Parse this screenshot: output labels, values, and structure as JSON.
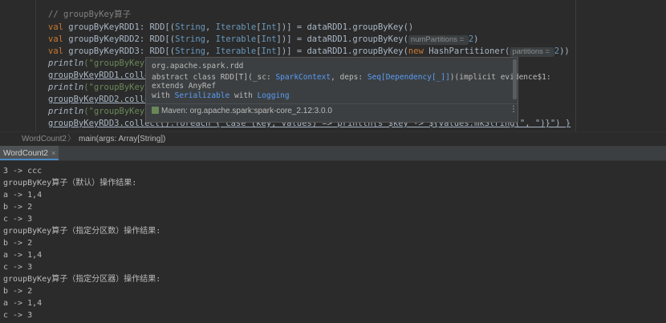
{
  "editor": {
    "lines": [
      {
        "comment": "// groupByKey算子"
      },
      {
        "val": "val",
        "name": "groupByKeyRDD1",
        "type_open": ": RDD[(",
        "t1": "String",
        "comma": ", ",
        "t2": "Iterable",
        "br": "[",
        "t3": "Int",
        "close": "])] = dataRDD1.groupByKey()"
      },
      {
        "val": "val",
        "name": "groupByKeyRDD2",
        "type_open": ": RDD[(",
        "t1": "String",
        "comma": ", ",
        "t2": "Iterable",
        "br": "[",
        "t3": "Int",
        "close": "])] = dataRDD1.groupByKey(",
        "hint": "numPartitions = ",
        "arg": "2",
        "end": ")"
      },
      {
        "val": "val",
        "name": "groupByKeyRDD3",
        "type_open": ": RDD[(",
        "t1": "String",
        "comma": ", ",
        "t2": "Iterable",
        "br": "[",
        "t3": "Int",
        "close": "])] = dataRDD1.groupByKey(",
        "new_kw": "new",
        "ctor": " HashPartitioner(",
        "hint": "partitions = ",
        "arg": "2",
        "end": "))"
      },
      {
        "fn": "println",
        "rest": "(\"groupByKey算"
      },
      {
        "text": "groupByKeyRDD1.collec"
      },
      {
        "fn": "println",
        "rest": "(\"groupByKey算"
      },
      {
        "text": "groupByKeyRDD2.collec"
      },
      {
        "fn": "println",
        "rest": "(\"groupByKey算"
      },
      {
        "text": "groupByKeyRDD3.collect().foreach { case (key, values) => println(s\"$key -> ${values.mkString(\", \")}\") }"
      }
    ]
  },
  "popup": {
    "package": "org.apache.spark.rdd",
    "sig_a": "abstract class RDD[T](_sc: ",
    "sig_b": "SparkContext",
    "sig_c": ", deps: ",
    "sig_d": "Seq[Dependency[_]]",
    "sig_e": ")(implicit evidence$1:",
    "extends": "extends AnyRef",
    "with_a": "with ",
    "with_b": "Serializable",
    "with_c": " with ",
    "with_d": "Logging",
    "maven": "Maven: org.apache.spark:spark-core_2.12:3.0.0",
    "more_icon": "⋮"
  },
  "breadcrumb": {
    "item1": "WordCount2",
    "sep": "〉",
    "item2": "main(args: Array[String])"
  },
  "tabs": [
    {
      "label": "WordCount2",
      "close": "×"
    }
  ],
  "console": {
    "lines": [
      "3 -> ccc",
      "groupByKey算子（默认）操作结果:",
      "a -> 1,4",
      "b -> 2",
      "c -> 3",
      "groupByKey算子（指定分区数）操作结果:",
      "b -> 2",
      "a -> 1,4",
      "c -> 3",
      "groupByKey算子（指定分区器）操作结果:",
      "b -> 2",
      "a -> 1,4",
      "c -> 3"
    ]
  }
}
